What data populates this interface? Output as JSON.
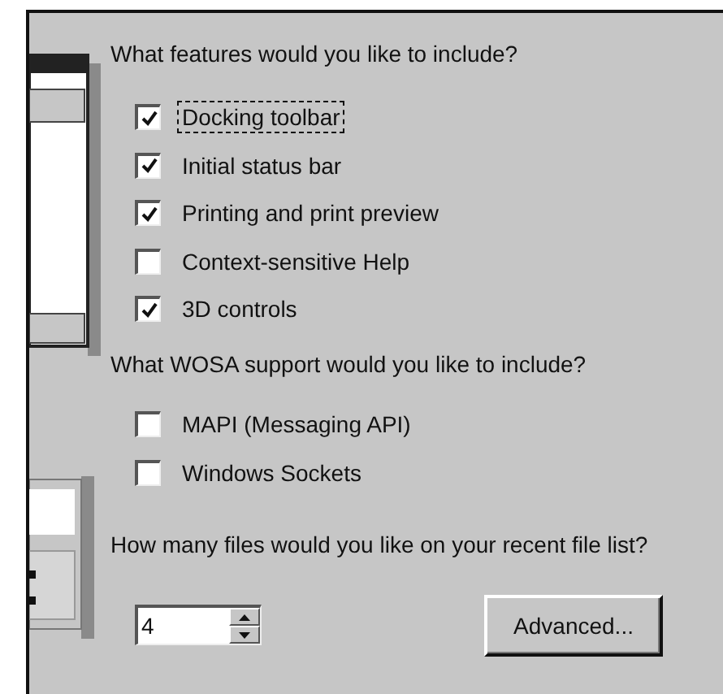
{
  "features_prompt": "What features would you like to include?",
  "features": [
    {
      "label": "Docking toolbar",
      "checked": true,
      "focused": true
    },
    {
      "label": "Initial status bar",
      "checked": true,
      "focused": false
    },
    {
      "label": "Printing and print preview",
      "checked": true,
      "focused": false
    },
    {
      "label": "Context-sensitive Help",
      "checked": false,
      "focused": false
    },
    {
      "label": "3D controls",
      "checked": true,
      "focused": false
    }
  ],
  "wosa_prompt": "What WOSA support would you like to include?",
  "wosa": [
    {
      "label": "MAPI (Messaging API)",
      "checked": false,
      "focused": false
    },
    {
      "label": "Windows Sockets",
      "checked": false,
      "focused": false
    }
  ],
  "recent_prompt": "How many files would you like on your recent file list?",
  "recent_files": {
    "value": "4"
  },
  "advanced_button": "Advanced..."
}
